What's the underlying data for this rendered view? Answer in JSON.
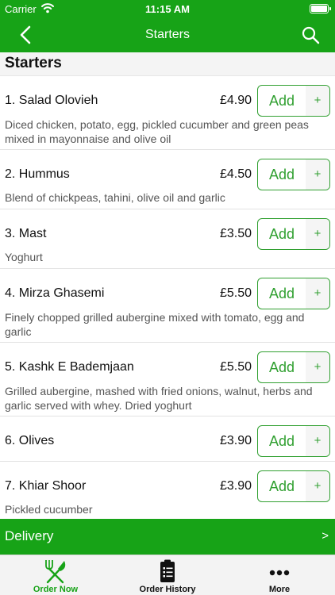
{
  "status_bar": {
    "carrier": "Carrier",
    "time": "11:15 AM"
  },
  "nav": {
    "title": "Starters"
  },
  "section": {
    "title": "Starters"
  },
  "colors": {
    "brand_green": "#17a317",
    "button_green": "#31a031"
  },
  "items": [
    {
      "name": "1. Salad Olovieh",
      "price": "£4.90",
      "add_label": "Add",
      "plus": "+",
      "description": "Diced chicken, potato, egg, pickled cucumber and green peas mixed in mayonnaise and olive oil"
    },
    {
      "name": "2. Hummus",
      "price": "£4.50",
      "add_label": "Add",
      "plus": "+",
      "description": "Blend of chickpeas, tahini, olive oil and garlic"
    },
    {
      "name": "3. Mast",
      "price": "£3.50",
      "add_label": "Add",
      "plus": "+",
      "description": "Yoghurt"
    },
    {
      "name": "4. Mirza Ghasemi",
      "price": "£5.50",
      "add_label": "Add",
      "plus": "+",
      "description": "Finely chopped grilled aubergine mixed with tomato, egg and garlic"
    },
    {
      "name": "5. Kashk E Bademjaan",
      "price": "£5.50",
      "add_label": "Add",
      "plus": "+",
      "description": "Grilled aubergine, mashed with fried onions, walnut, herbs and garlic served with whey. Dried yoghurt"
    },
    {
      "name": "6. Olives",
      "price": "£3.90",
      "add_label": "Add",
      "plus": "+",
      "description": ""
    },
    {
      "name": "7. Khiar Shoor",
      "price": "£3.90",
      "add_label": "Add",
      "plus": "+",
      "description": "Pickled cucumber"
    }
  ],
  "delivery": {
    "label": "Delivery",
    "chevron": ">"
  },
  "tabs": [
    {
      "label": "Order Now",
      "icon": "fork-knife-icon",
      "active": true
    },
    {
      "label": "Order History",
      "icon": "clipboard-list-icon",
      "active": false
    },
    {
      "label": "More",
      "icon": "more-dots-icon",
      "active": false
    }
  ]
}
